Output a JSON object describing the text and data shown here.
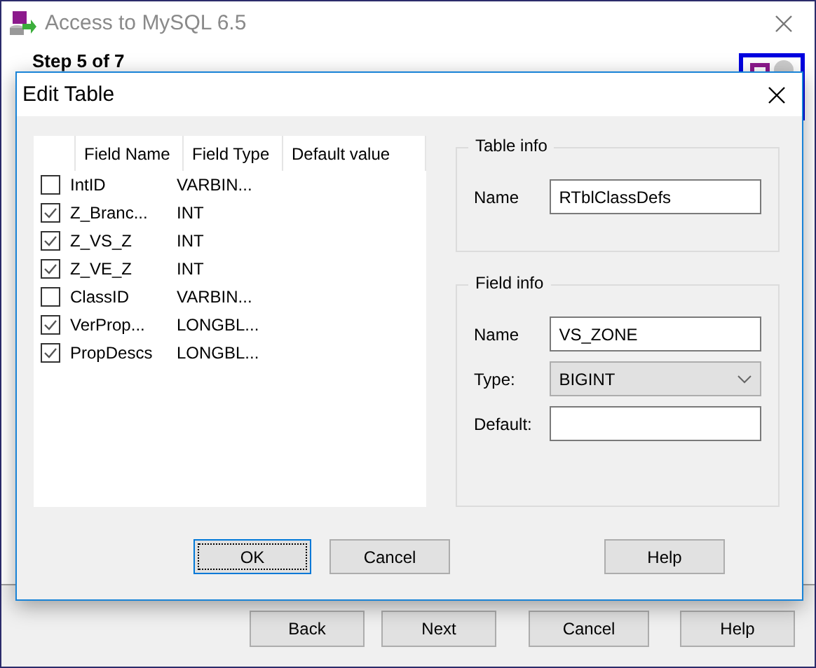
{
  "window": {
    "title": "Access to MySQL 6.5",
    "step": "Step 5 of 7"
  },
  "dialog": {
    "title": "Edit Table",
    "columns": [
      "Field Name",
      "Field Type",
      "Default value"
    ],
    "rows": [
      {
        "checked": false,
        "name": "IntID",
        "type": "VARBIN..."
      },
      {
        "checked": true,
        "name": "Z_Branc...",
        "type": "INT"
      },
      {
        "checked": true,
        "name": "Z_VS_Z",
        "type": "INT"
      },
      {
        "checked": true,
        "name": "Z_VE_Z",
        "type": "INT"
      },
      {
        "checked": false,
        "name": "ClassID",
        "type": "VARBIN..."
      },
      {
        "checked": true,
        "name": "VerProp...",
        "type": "LONGBL..."
      },
      {
        "checked": true,
        "name": "PropDescs",
        "type": "LONGBL..."
      }
    ],
    "table_info": {
      "title": "Table info",
      "name_label": "Name",
      "name_value": "RTblClassDefs"
    },
    "field_info": {
      "title": "Field info",
      "name_label": "Name",
      "name_value": "VS_ZONE",
      "type_label": "Type:",
      "type_value": "BIGINT",
      "default_label": "Default:"
    },
    "buttons": [
      {
        "label": "OK",
        "focused": true
      },
      {
        "label": "Cancel",
        "focused": false
      },
      {
        "label": "Help",
        "focused": false
      }
    ]
  },
  "wizard_buttons": [
    "Back",
    "Next",
    "Cancel",
    "Help"
  ]
}
